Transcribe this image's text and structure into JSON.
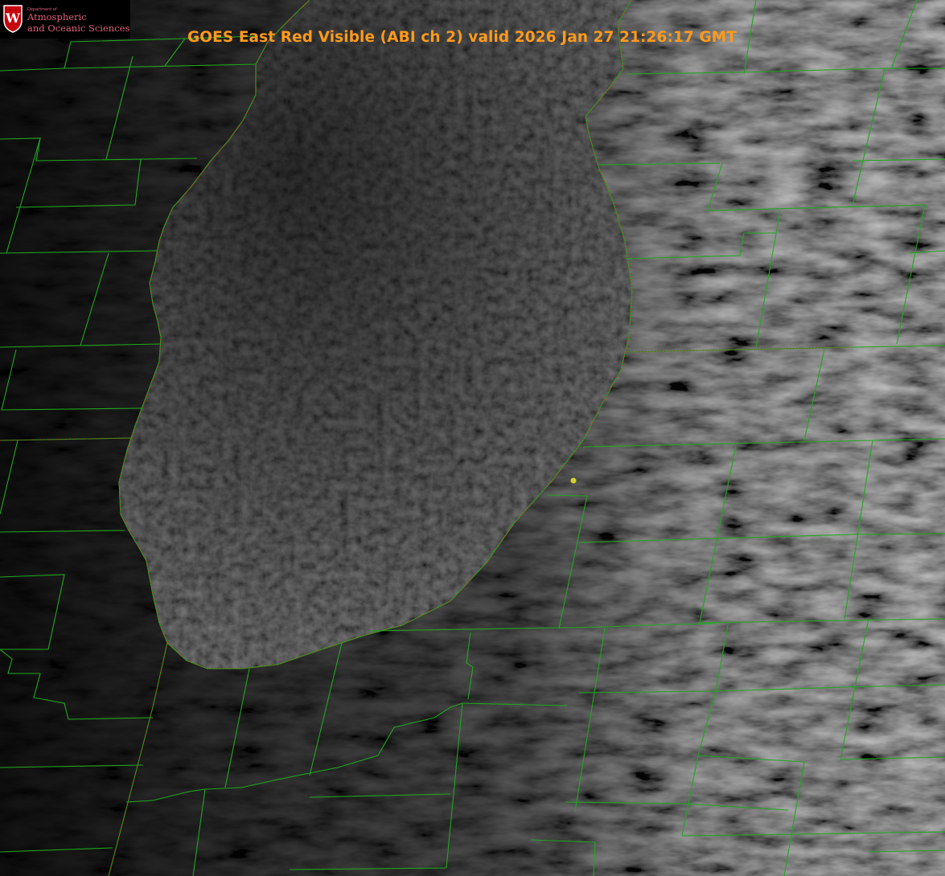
{
  "title": "GOES East Red Visible (ABI ch 2) valid 2026 Jan 27 21:26:17 GMT",
  "logo": {
    "crest_letter": "W",
    "department": "Department of",
    "line1": "Atmospheric",
    "line2": "and Oceanic Sciences"
  },
  "colors": {
    "title": "#ff9a1a",
    "county_lines": "#1fa81f",
    "state_lines": "#c0391f",
    "station_marker": "#d8d030",
    "logo_text": "#e0607a",
    "crest": "#c5050c"
  },
  "icons": {
    "crest": "uw-crest-icon",
    "station": "station-dot-icon"
  }
}
